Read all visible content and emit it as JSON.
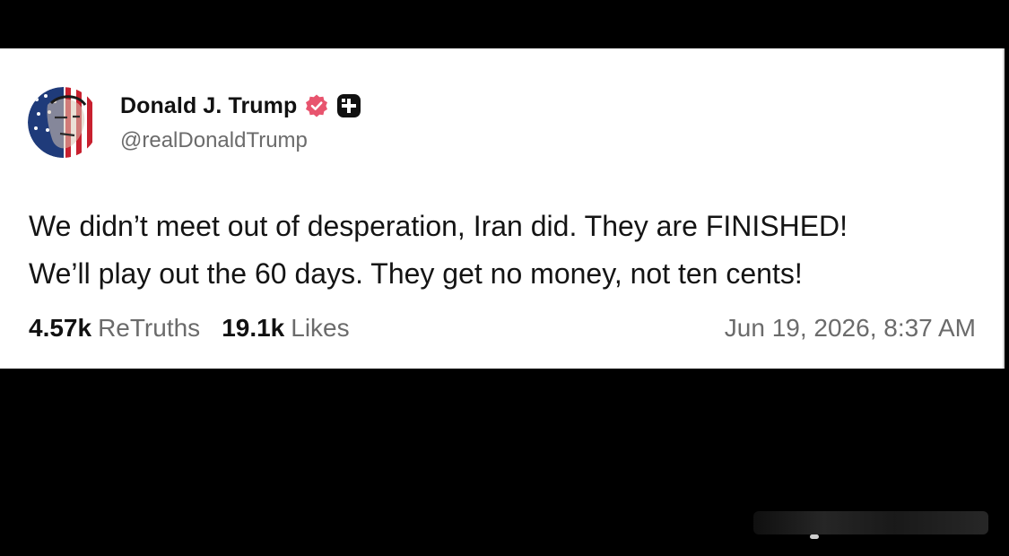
{
  "post": {
    "author": {
      "display_name": "Donald J. Trump",
      "handle": "@realDonaldTrump",
      "verified": true,
      "avatar_icon": "flag-portrait-avatar",
      "badge_icon": "verified-badge-icon",
      "badge_color": "#e8546e",
      "extra_icon": "plus-square-icon"
    },
    "text_lines": [
      "We didn’t meet out of desperation, Iran did. They are FINISHED!",
      "We’ll play out the 60 days. They get no money, not ten cents!"
    ],
    "stats": {
      "retruths_count": "4.57k",
      "retruths_label": "ReTruths",
      "likes_count": "19.1k",
      "likes_label": "Likes"
    },
    "timestamp": "Jun 19, 2026, 8:37 AM"
  },
  "colors": {
    "background": "#000000",
    "card": "#ffffff",
    "primary_text": "#141414",
    "secondary_text": "#6b6b6b"
  }
}
